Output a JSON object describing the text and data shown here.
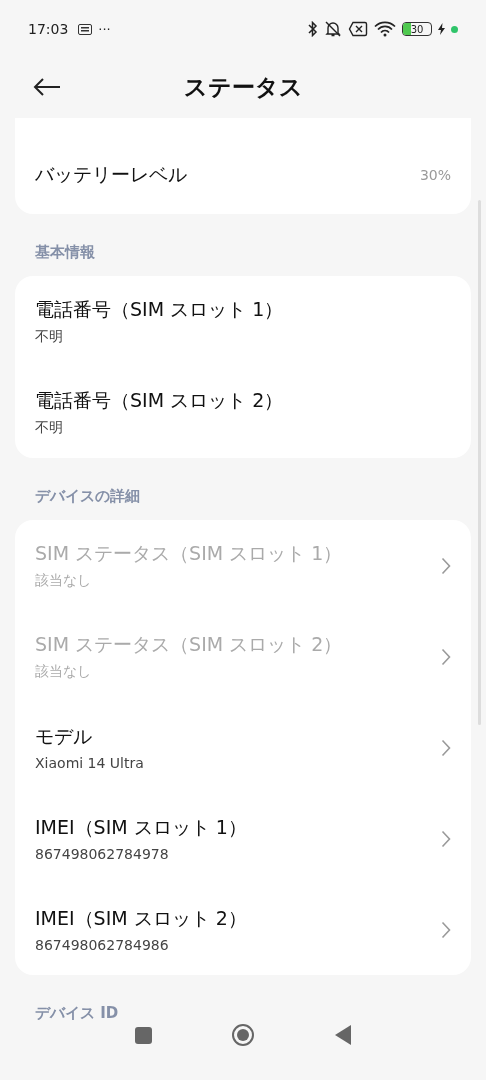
{
  "status_bar": {
    "time": "17:03",
    "more": "···",
    "battery": {
      "text": "30",
      "level": 0.3
    }
  },
  "header": {
    "title": "ステータス"
  },
  "sections": [
    {
      "items": [
        {
          "kind": "info",
          "title": "バッテリーレベル",
          "value": "30%",
          "disabled": false
        }
      ]
    },
    {
      "header": "基本情報",
      "items": [
        {
          "kind": "info",
          "title": "電話番号（SIM スロット 1）",
          "subtitle": "不明",
          "disabled": false
        },
        {
          "kind": "info",
          "title": "電話番号（SIM スロット 2）",
          "subtitle": "不明",
          "disabled": false
        }
      ]
    },
    {
      "header": "デバイスの詳細",
      "items": [
        {
          "kind": "link",
          "title": "SIM ステータス（SIM スロット 1）",
          "subtitle": "該当なし",
          "disabled": true
        },
        {
          "kind": "link",
          "title": "SIM ステータス（SIM スロット 2）",
          "subtitle": "該当なし",
          "disabled": true
        },
        {
          "kind": "link",
          "title": "モデル",
          "subtitle": "Xiaomi 14 Ultra",
          "disabled": false
        },
        {
          "kind": "link",
          "title": "IMEI（SIM スロット 1）",
          "subtitle": "867498062784978",
          "disabled": false
        },
        {
          "kind": "link",
          "title": "IMEI（SIM スロット 2）",
          "subtitle": "867498062784986",
          "disabled": false
        }
      ]
    },
    {
      "header": "デバイス ID"
    }
  ]
}
